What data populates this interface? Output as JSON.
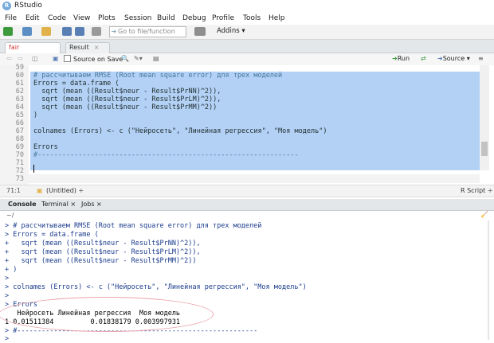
{
  "window": {
    "title": "RStudio",
    "logo_letter": "R"
  },
  "menu": [
    "File",
    "Edit",
    "Code",
    "View",
    "Plots",
    "Session",
    "Build",
    "Debug",
    "Profile",
    "Tools",
    "Help"
  ],
  "toolbar": {
    "goto_placeholder": "Go to file/function",
    "addins_label": "Addins ▾"
  },
  "editor": {
    "tabs": [
      {
        "label": "fair price.R*",
        "active": true
      },
      {
        "label": "Result",
        "active": false
      }
    ],
    "source_on_save": "Source on Save",
    "run_label": "Run",
    "source_label": "Source ▾",
    "lines": [
      {
        "num": "59",
        "text": ""
      },
      {
        "num": "60",
        "text": "# рассчитываем RMSE (Root mean square error) для трех моделей"
      },
      {
        "num": "61",
        "text": "Errors = data.frame ("
      },
      {
        "num": "62",
        "text": "  sqrt (mean ((Result$neur - Result$PrNN)^2)),"
      },
      {
        "num": "63",
        "text": "  sqrt (mean ((Result$neur - Result$PrLM)^2)),"
      },
      {
        "num": "64",
        "text": "  sqrt (mean ((Result$neur - Result$PrMM)^2))"
      },
      {
        "num": "65",
        "text": ")"
      },
      {
        "num": "66",
        "text": ""
      },
      {
        "num": "67",
        "text": "colnames (Errors) <- c (\"Нейросеть\", \"Линейная регрессия\", \"Моя модель\")"
      },
      {
        "num": "68",
        "text": ""
      },
      {
        "num": "69",
        "text": "Errors"
      },
      {
        "num": "70",
        "text": "#----------------------------------------------------------------"
      },
      {
        "num": "71",
        "text": ""
      },
      {
        "num": "72",
        "text": ""
      },
      {
        "num": "73",
        "text": ""
      }
    ],
    "status": {
      "position": "71:1",
      "scope": "(Untitled) ÷",
      "filetype": "R Script ÷"
    }
  },
  "console": {
    "tabs": [
      "Console",
      "Terminal ×",
      "Jobs ×"
    ],
    "path": "~/",
    "lines": [
      {
        "text": "> # рассчитываем RMSE (Root mean square error) для трех моделей",
        "kind": "in"
      },
      {
        "text": "> Errors = data.frame (",
        "kind": "in"
      },
      {
        "text": "+   sqrt (mean ((Result$neur - Result$PrNN)^2)),",
        "kind": "in"
      },
      {
        "text": "+   sqrt (mean ((Result$neur - Result$PrLM)^2)),",
        "kind": "in"
      },
      {
        "text": "+   sqrt (mean ((Result$neur - Result$PrMM)^2))",
        "kind": "in"
      },
      {
        "text": "+ )",
        "kind": "in"
      },
      {
        "text": ">",
        "kind": "in"
      },
      {
        "text": "> colnames (Errors) <- c (\"Нейросеть\", \"Линейная регрессия\", \"Моя модель\")",
        "kind": "in"
      },
      {
        "text": ">",
        "kind": "in"
      },
      {
        "text": "> Errors",
        "kind": "in"
      },
      {
        "text": "   Нейросеть Линейная регрессия  Моя модель",
        "kind": "out"
      },
      {
        "text": "1 0.01511384         0.01838179 0.003997931",
        "kind": "out"
      },
      {
        "text": "> #-----------------------------------------------------------",
        "kind": "in"
      },
      {
        "text": ">",
        "kind": "in"
      }
    ]
  },
  "colors": {
    "selection": "#b3d0f5",
    "comment": "#46799c",
    "highlight_circle": "#e9a3ad"
  }
}
